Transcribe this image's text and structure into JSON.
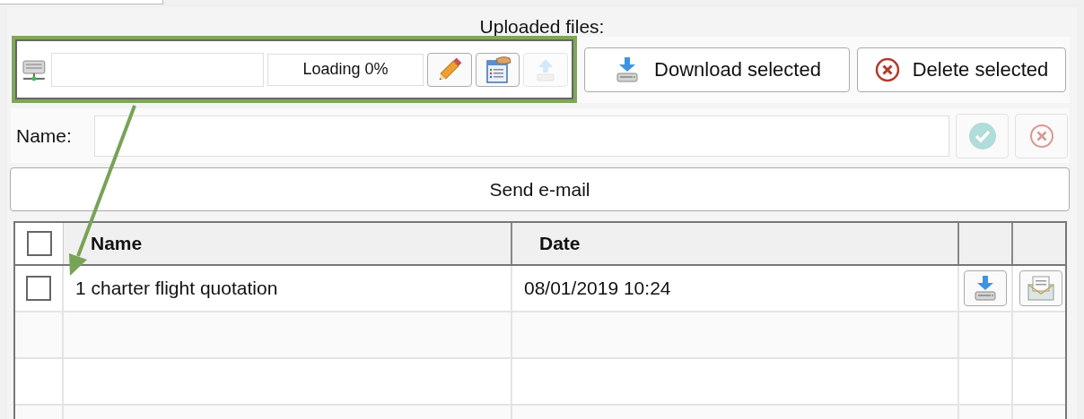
{
  "title": "Uploaded files:",
  "upload_bar": {
    "highlighted": true,
    "progress_label": "Loading 0%",
    "tools": [
      {
        "kind": "edit",
        "disabled": false
      },
      {
        "kind": "notes",
        "disabled": false
      },
      {
        "kind": "upload",
        "disabled": true
      }
    ]
  },
  "actions": [
    {
      "kind": "download",
      "label": "Download selected"
    },
    {
      "kind": "delete",
      "label": "Delete selected"
    }
  ],
  "name_form": {
    "label": "Name:",
    "buttons": [
      {
        "kind": "confirm",
        "disabled": true
      },
      {
        "kind": "cancel",
        "disabled": true
      }
    ]
  },
  "send_button": "Send e-mail",
  "table": {
    "all_checked": false,
    "columns": [
      "Name",
      "Date"
    ],
    "rows": [
      {
        "checked": false,
        "name": "1 charter flight quotation",
        "date": "08/01/2019 10:24",
        "actions": [
          {
            "kind": "download"
          },
          {
            "kind": "email"
          }
        ]
      }
    ]
  },
  "callout_arrow": true
}
